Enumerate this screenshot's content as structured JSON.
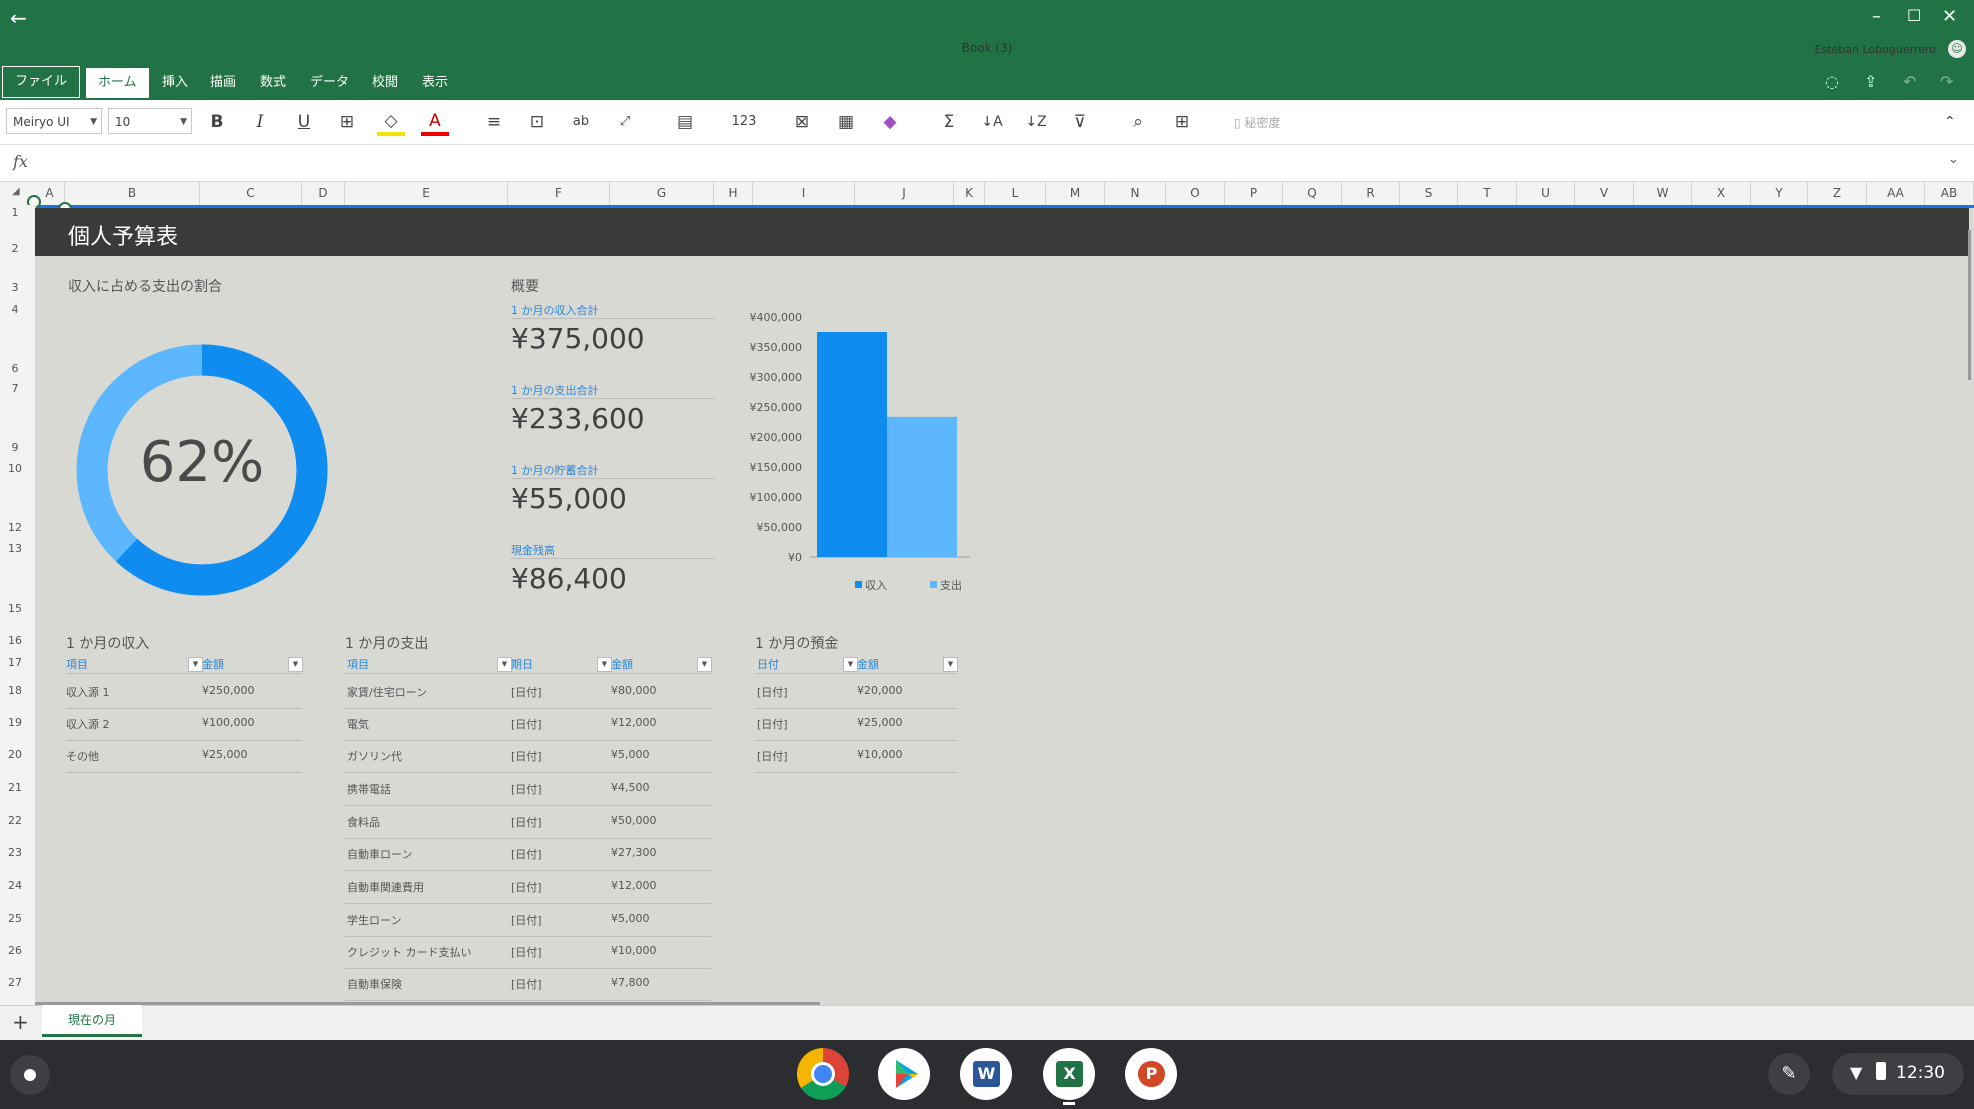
{
  "window": {
    "back": "←",
    "title": "Book (3)",
    "user": "Esteban Loboguerrero"
  },
  "ribbon_tabs": [
    "ファイル",
    "ホーム",
    "挿入",
    "描画",
    "数式",
    "データ",
    "校閲",
    "表示"
  ],
  "toolbar": {
    "font_name": "Meiryo UI",
    "font_size": "10",
    "sensitivity_label": "秘密度"
  },
  "formula_bar": {
    "fx": "fx",
    "value": ""
  },
  "columns": [
    "A",
    "B",
    "C",
    "D",
    "E",
    "F",
    "G",
    "H",
    "I",
    "J",
    "K",
    "L",
    "M",
    "N",
    "O",
    "P",
    "Q",
    "R",
    "S",
    "T",
    "U",
    "V",
    "W",
    "X",
    "Y",
    "Z",
    "AA",
    "AB"
  ],
  "rows": [
    "1",
    "2",
    "3",
    "4",
    "6",
    "7",
    "9",
    "10",
    "12",
    "13",
    "15",
    "16",
    "17",
    "18",
    "19",
    "20",
    "21",
    "22",
    "23",
    "24",
    "25",
    "26",
    "27"
  ],
  "sheet": {
    "title": "個人予算表",
    "donut": {
      "label": "収入に占める支出の割合",
      "value": "62%",
      "percent": 62
    },
    "summary": {
      "heading": "概要",
      "items": [
        {
          "label": "1 か月の収入合計",
          "value": "¥375,000"
        },
        {
          "label": "1 か月の支出合計",
          "value": "¥233,600"
        },
        {
          "label": "1 か月の貯蓄合計",
          "value": "¥55,000"
        },
        {
          "label": "現金残高",
          "value": "¥86,400"
        }
      ]
    },
    "income": {
      "title": "1 か月の収入",
      "headers": [
        "項目",
        "金額"
      ],
      "rows": [
        [
          "収入源 1",
          "¥250,000"
        ],
        [
          "収入源 2",
          "¥100,000"
        ],
        [
          "その他",
          "¥25,000"
        ]
      ]
    },
    "expenses": {
      "title": "1 か月の支出",
      "headers": [
        "項目",
        "期日",
        "金額"
      ],
      "rows": [
        [
          "家賃/住宅ローン",
          "[日付]",
          "¥80,000"
        ],
        [
          "電気",
          "[日付]",
          "¥12,000"
        ],
        [
          "ガソリン代",
          "[日付]",
          "¥5,000"
        ],
        [
          "携帯電話",
          "[日付]",
          "¥4,500"
        ],
        [
          "食料品",
          "[日付]",
          "¥50,000"
        ],
        [
          "自動車ローン",
          "[日付]",
          "¥27,300"
        ],
        [
          "自動車関連費用",
          "[日付]",
          "¥12,000"
        ],
        [
          "学生ローン",
          "[日付]",
          "¥5,000"
        ],
        [
          "クレジット カード支払い",
          "[日付]",
          "¥10,000"
        ],
        [
          "自動車保険",
          "[日付]",
          "¥7,800"
        ]
      ]
    },
    "savings": {
      "title": "1 か月の預金",
      "headers": [
        "日付",
        "金額"
      ],
      "rows": [
        [
          "[日付]",
          "¥20,000"
        ],
        [
          "[日付]",
          "¥25,000"
        ],
        [
          "[日付]",
          "¥10,000"
        ]
      ]
    }
  },
  "chart_data": {
    "type": "bar",
    "categories": [
      "収入",
      "支出"
    ],
    "values": [
      375000,
      233600
    ],
    "colors": [
      "#0f8cf0",
      "#5cb7ff"
    ],
    "ylim": [
      0,
      400000
    ],
    "yticks": [
      "¥400,000",
      "¥350,000",
      "¥300,000",
      "¥250,000",
      "¥200,000",
      "¥150,000",
      "¥100,000",
      "¥50,000",
      "¥0"
    ],
    "legend": [
      "収入",
      "支出"
    ],
    "legend_position": "bottom"
  },
  "sheet_tabs": {
    "add": "+",
    "active": "現在の月"
  },
  "shelf": {
    "apps": [
      "chrome-icon",
      "play-store-icon",
      "word-icon",
      "excel-icon",
      "powerpoint-icon"
    ],
    "time": "12:30"
  },
  "colors": {
    "brand": "#217346",
    "accent": "#0f8cf0",
    "accent_light": "#5cb7ff"
  }
}
